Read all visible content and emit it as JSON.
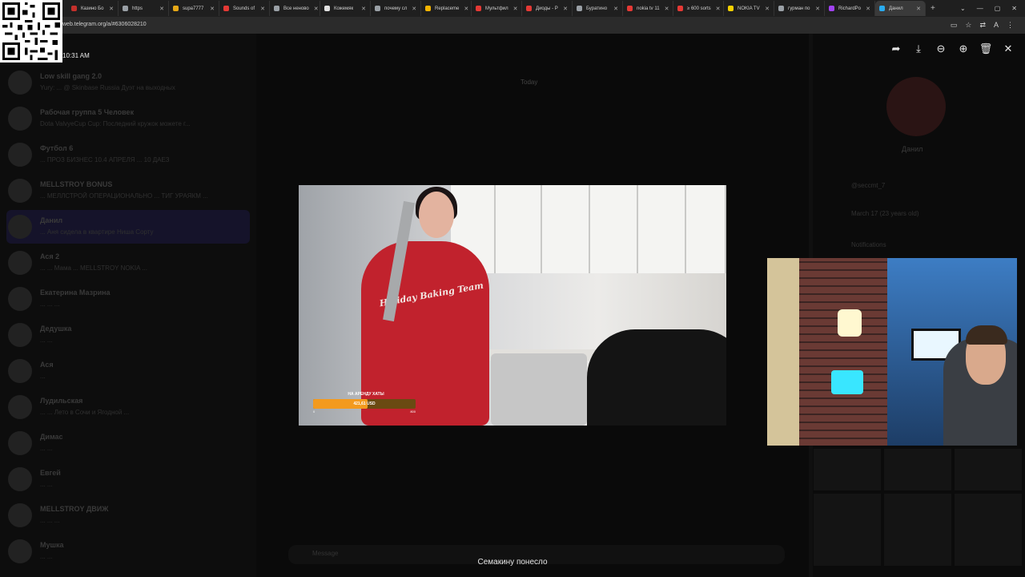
{
  "browser": {
    "tabs": [
      {
        "label": "Казино Бо",
        "color": "#c4302b"
      },
      {
        "label": "https",
        "color": "#9aa0a6"
      },
      {
        "label": "supa7777",
        "color": "#e6a817"
      },
      {
        "label": "Sounds of",
        "color": "#e53935"
      },
      {
        "label": "Все неново",
        "color": "#9aa0a6"
      },
      {
        "label": "Кожемяк",
        "color": "#e0e0e0"
      },
      {
        "label": "почему сл",
        "color": "#9aa0a6"
      },
      {
        "label": "Replaceme",
        "color": "#f4b400"
      },
      {
        "label": "Мультфил",
        "color": "#e53935"
      },
      {
        "label": "Диоды - Р",
        "color": "#e53935"
      },
      {
        "label": "Буратино",
        "color": "#9aa0a6"
      },
      {
        "label": "nokia tv 11",
        "color": "#e53935"
      },
      {
        "label": "≥ 600 sorts",
        "color": "#e53935"
      },
      {
        "label": "NOKIA TV",
        "color": "#f6d100"
      },
      {
        "label": "гурман по",
        "color": "#9aa0a6"
      },
      {
        "label": "RichardPo",
        "color": "#a142f4"
      },
      {
        "label": "Данил",
        "color": "#2aabee",
        "active": true
      }
    ],
    "new_tab": "+",
    "url": "web.telegram.org/a/#6306028210"
  },
  "clock": "10:31 AM",
  "chat_list": [
    {
      "name": "Low skill gang 2.0",
      "preview": "Yury: ... @ Skinbase Russia Дуэт на выходных"
    },
    {
      "name": "Рабочая группа 5 Человек",
      "preview": "Dota ValvyeCup Cup: Последний кружок можете г..."
    },
    {
      "name": "Футбол 6",
      "preview": "... ПРОЗ БИЗНЕС 10.4 АПРЕЛЯ ... 10 ДАЕЗ"
    },
    {
      "name": "MELLSTROY BONUS",
      "preview": "... МЕЛЛСТРОЙ ОПЕРАЦИОНАЛЬНО ... ТИГ УРАЯКМ ..."
    },
    {
      "name": "Данил",
      "preview": "... Аня сидела в квартире Ниша Сорту",
      "selected": true
    },
    {
      "name": "Ася 2",
      "preview": "... ... Мама ... MELLSTROY NOKIA ..."
    },
    {
      "name": "Екатерина Мазрина",
      "preview": "... ... ..."
    },
    {
      "name": "Дедушка",
      "preview": "... ..."
    },
    {
      "name": "Ася",
      "preview": "..."
    },
    {
      "name": "Лудильская",
      "preview": "... ... Лето в Сочи и Ягодной ..."
    },
    {
      "name": "Димас",
      "preview": "... ..."
    },
    {
      "name": "Евгей",
      "preview": "... ..."
    },
    {
      "name": "MELLSTROY ДВИЖ",
      "preview": "... ... ..."
    },
    {
      "name": "Мушка",
      "preview": "... ..."
    }
  ],
  "chat": {
    "day_label": "Today",
    "compose_placeholder": "Message"
  },
  "profile": {
    "name": "Данил",
    "username": "@seccmt_7",
    "birthday": "March 17 (23 years old)",
    "notifications": "Notifications"
  },
  "viewer": {
    "icons": [
      "forward-icon",
      "download-icon",
      "zoom-out-icon",
      "zoom-in-icon",
      "delete-icon",
      "close-icon"
    ]
  },
  "stream": {
    "donation_title": "НА АРЕНДУ ХАТЫ",
    "donation_amount": "421,61 USD",
    "donation_min": "0",
    "donation_max": "800",
    "donation_progress_fraction": 0.53,
    "sweater_text": "Holiday Baking Team"
  },
  "caption": "Семакину понесло"
}
